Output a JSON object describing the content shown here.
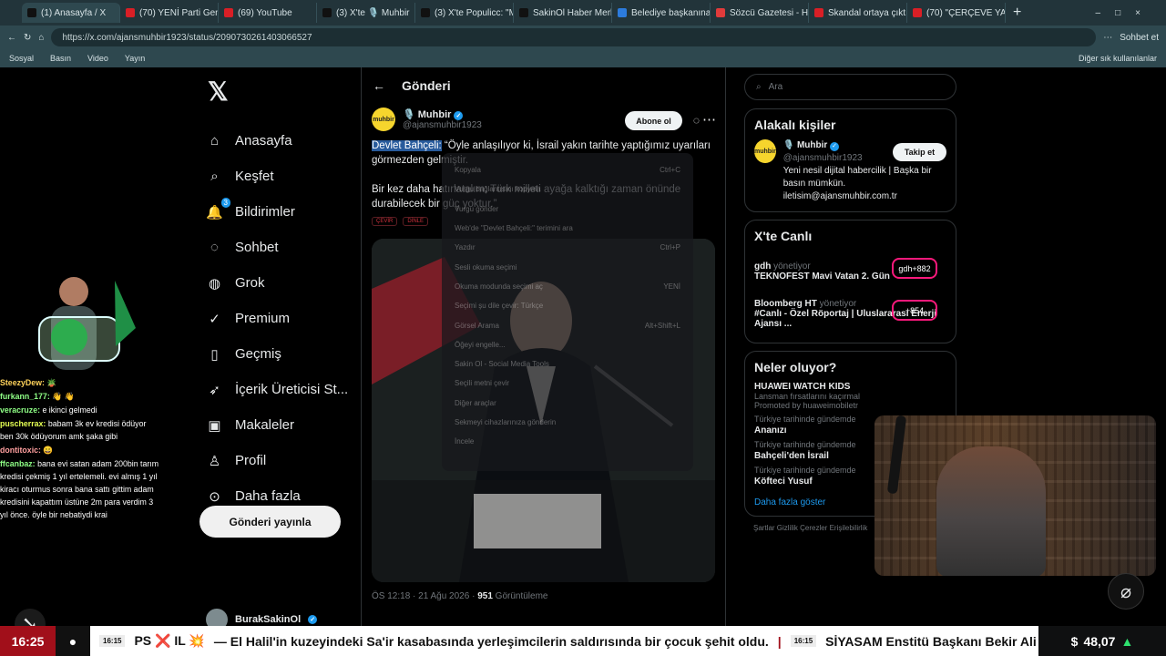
{
  "tabs": [
    {
      "title": "(1) Anasayfa / X",
      "color": "#111111"
    },
    {
      "title": "(70) YENİ Parti Gene",
      "color": "#d91f26"
    },
    {
      "title": "(69) YouTube",
      "color": "#d91f26"
    },
    {
      "title": "(3) X'te 🎙️ Muhbir",
      "color": "#111111"
    },
    {
      "title": "(3) X'te Populicc: \"M",
      "color": "#111111"
    },
    {
      "title": "SakinOl Haber Merk",
      "color": "#111111"
    },
    {
      "title": "Belediye başkanına",
      "color": "#2c7bdc"
    },
    {
      "title": "Sözcü Gazetesi - Ha",
      "color": "#e13b3b"
    },
    {
      "title": "Skandal ortaya çıktı",
      "color": "#d91f26"
    },
    {
      "title": "(70) \"ÇERÇEVE YASA",
      "color": "#d91f26"
    }
  ],
  "address": {
    "url": "https://x.com/ajansmuhbir1923/status/2090730261403066527",
    "sync_label": "Sohbet et"
  },
  "bookmarks": [
    "Sosyal",
    "Basın",
    "Video",
    "Yayın"
  ],
  "bookmark_right": "Diğer sık kullanılanlar",
  "nav": {
    "items": [
      "Anasayfa",
      "Keşfet",
      "Bildirimler",
      "Sohbet",
      "Grok",
      "Premium",
      "Geçmiş",
      "İçerik Üreticisi St...",
      "Makaleler",
      "Profil",
      "Daha fazla"
    ],
    "badge": "3",
    "post_button": "Gönderi yayınla",
    "mini_profile": "BurakSakinOl"
  },
  "post": {
    "header": "Gönderi",
    "author": "🎙️ Muhbir",
    "handle": "@ajansmuhbir1923",
    "follow_label": "Abone ol",
    "highlighted_name": "Devlet Bahçeli:",
    "line1_rest": " “Öyle anlaşılıyor ki, İsrail yakın tarihte yaptığımız uyarıları görmezden gelmiştir.",
    "line2": "Bir kez daha hatırlatalım; Türk milleti ayağa kalktığı zaman önünde durabilecek bir güç yoktur.”",
    "tag1": "ÇEVİR",
    "tag2": "DİNLE",
    "meta_time": "ÖS 12:18 · 21 Ağu 2026 · ",
    "views": "951",
    "views_label": " Görüntüleme"
  },
  "context_menu": [
    [
      "Kopyala",
      "Ctrl+C"
    ],
    [
      "Vurgu bağlantısını kopyala",
      ""
    ],
    [
      "Vurgu gönder",
      ""
    ],
    [
      "Web'de \"Devlet Bahçeli:\" terimini ara",
      ""
    ],
    [
      "Yazdır",
      "Ctrl+P"
    ],
    [
      "Sesli okuma seçimi",
      ""
    ],
    [
      "Okuma modunda seçimi aç",
      "YENİ"
    ],
    [
      "Seçimi şu dile çevir: Türkçe",
      ""
    ],
    [
      "Görsel Arama",
      "Alt+Shift+L"
    ],
    [
      "Öğeyi engelle...",
      ""
    ],
    [
      "Sakin Ol - Social Media Tools",
      ""
    ],
    [
      "Seçili metni çevir",
      ""
    ],
    [
      "Diğer araçlar",
      ""
    ],
    [
      "Sekmeyi cihazlarınıza gönderin",
      ""
    ],
    [
      "İncele",
      ""
    ]
  ],
  "right": {
    "search_placeholder": "Ara",
    "related_title": "Alakalı kişiler",
    "related_name": "🎙️ Muhbir",
    "related_handle": "@ajansmuhbir1923",
    "related_bio": "Yeni nesil dijital habercilik | Başka bir basın mümkün. iletisim@ajansmuhbir.com.tr",
    "follow": "Takip et",
    "live_title": "X'te Canlı",
    "live1_host": "gdh",
    "live1_role": "yönetiyor",
    "live1_title": "TEKNOFEST Mavi Vatan 2. Gün",
    "live1_count": "+882",
    "live2_host": "Bloomberg HT",
    "live2_role": "yönetiyor",
    "live2_title": "#Canlı - Özel Röportaj | Uluslararası Enerji Ajansı ...",
    "live2_count": "+854",
    "news_title": "Neler oluyor?",
    "trend0_title": "HUAWEI WATCH KIDS",
    "trend0_desc": "Lansman fırsatlarını kaçırmal",
    "trend0_promo": "Promoted by huaweimobiletr",
    "trend_label": "Türkiye tarihinde gündemde",
    "trend1": "Ananızı",
    "trend2": "Bahçeli'den İsrail",
    "trend3": "Köfteci Yusuf",
    "show_more": "Daha fazla göster",
    "footer": "Şartlar  Gizlilik  Çerezler  Erişilebilirlik"
  },
  "chat": [
    {
      "user": "SteezyDew:",
      "message": "🪴"
    },
    {
      "user": "furkann_177:",
      "message": "👋 👋"
    },
    {
      "user": "veracruze:",
      "message": "e ikinci gelmedi"
    },
    {
      "user": "puscherrax:",
      "message": "babam 3k ev kredisi ödüyor ben 30k ödüyorum amk şaka gibi"
    },
    {
      "user": "dontitoxic:",
      "message": "😄"
    },
    {
      "user": "ffcanbaz:",
      "message": "bana evi satan adam 200bin tarım kredisi çekmiş 1 yıl ertelemeli. evi almış 1 yıl kiracı oturmus sonra bana sattı gittim adam kredisini kapattım üstüne 2m para verdim 3 yıl önce. öyle bir nebatiydi krai"
    }
  ],
  "ticker": {
    "time": "16:25",
    "news1": "— El Halil'in kuzeyindeki Sa'ir kasabasında yerleşimcilerin saldırısında bir çocuk şehit oldu.",
    "news_time": "16:15",
    "news2": "SİYASAM Enstitü Başkanı Bekir Ali",
    "price": "48,07",
    "price_symbol": "$"
  },
  "colors": {
    "accent": "#1d9bf0",
    "ticker_red": "#a10f1a",
    "live_pink": "#f9197b"
  }
}
